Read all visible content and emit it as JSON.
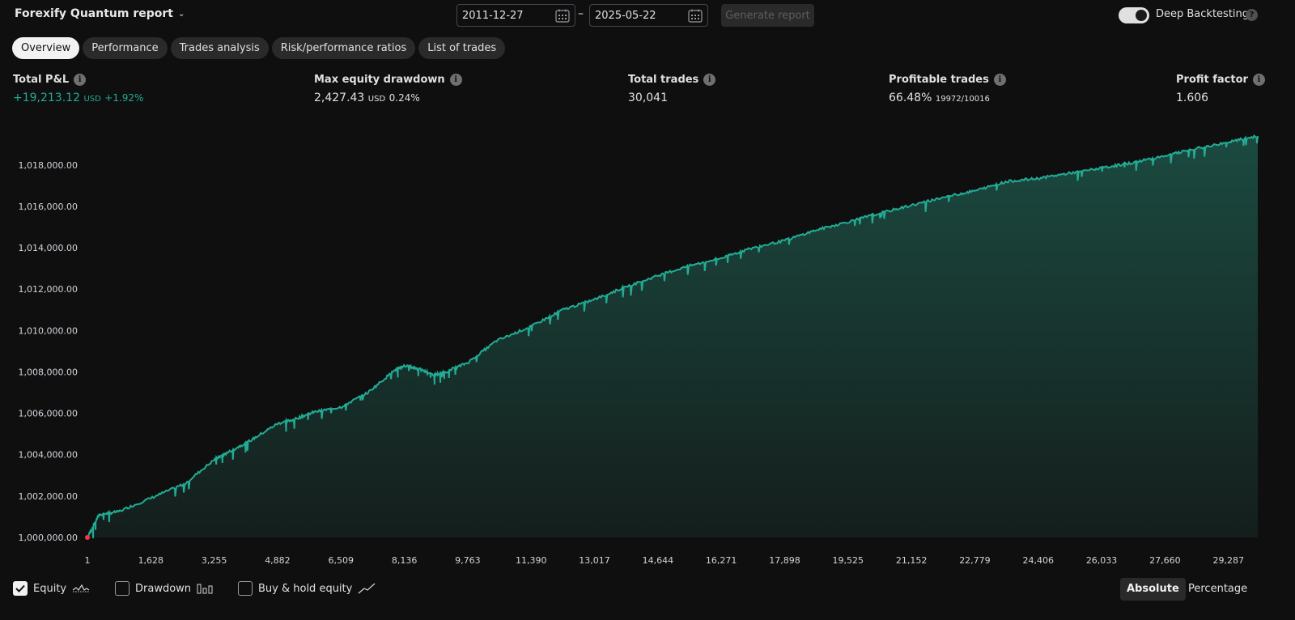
{
  "header": {
    "title": "Forexify Quantum report",
    "date_from": "2011-12-27",
    "date_to": "2025-05-22",
    "date_separator": "–",
    "generate_label": "Generate report",
    "deep_backtesting_label": "Deep Backtesting",
    "deep_backtesting_on": true
  },
  "tabs": [
    {
      "label": "Overview",
      "active": true
    },
    {
      "label": "Performance",
      "active": false
    },
    {
      "label": "Trades analysis",
      "active": false
    },
    {
      "label": "Risk/performance ratios",
      "active": false
    },
    {
      "label": "List of trades",
      "active": false
    }
  ],
  "metrics": {
    "total_pnl": {
      "label": "Total P&L",
      "value": "+19,213.12",
      "unit": "USD",
      "percent": "+1.92%"
    },
    "max_drawdown": {
      "label": "Max equity drawdown",
      "value": "2,427.43",
      "unit": "USD",
      "percent": "0.24%"
    },
    "total_trades": {
      "label": "Total trades",
      "value": "30,041"
    },
    "profitable_trades": {
      "label": "Profitable trades",
      "value": "66.48%",
      "ratio": "19972/10016"
    },
    "profit_factor": {
      "label": "Profit factor",
      "value": "1.606"
    }
  },
  "colors": {
    "equity_line": "#22ab94",
    "equity_fill_top": "#1b4a40",
    "equity_fill_bottom": "#141e1c",
    "background": "#0f0f0f"
  },
  "chart_data": {
    "type": "area",
    "y_tick_labels": [
      "1,000,000.00",
      "1,002,000.00",
      "1,004,000.00",
      "1,006,000.00",
      "1,008,000.00",
      "1,010,000.00",
      "1,012,000.00",
      "1,014,000.00",
      "1,016,000.00",
      "1,018,000.00"
    ],
    "y_ticks": [
      1000000,
      1002000,
      1004000,
      1006000,
      1008000,
      1010000,
      1012000,
      1014000,
      1016000,
      1018000
    ],
    "x_tick_labels": [
      "1",
      "1,628",
      "3,255",
      "4,882",
      "6,509",
      "8,136",
      "9,763",
      "11,390",
      "13,017",
      "14,644",
      "16,271",
      "17,898",
      "19,525",
      "21,152",
      "22,779",
      "24,406",
      "26,033",
      "27,660",
      "29,287"
    ],
    "x_ticks": [
      1,
      1628,
      3255,
      4882,
      6509,
      8136,
      9763,
      11390,
      13017,
      14644,
      16271,
      17898,
      19525,
      21152,
      22779,
      24406,
      26033,
      27660,
      29287
    ],
    "xlim": [
      1,
      30041
    ],
    "ylim": [
      1000000,
      1019400
    ],
    "series": [
      {
        "x": [
          1,
          300,
          800,
          1628,
          2500,
          3255,
          3600,
          4200,
          4882,
          5300,
          5800,
          6509,
          7200,
          7900,
          8136,
          8500,
          8900,
          9200,
          9763,
          10500,
          11390,
          12200,
          13017,
          13800,
          14644,
          15400,
          16271,
          17000,
          17898,
          18700,
          19525,
          20300,
          21152,
          22000,
          22779,
          23600,
          24406,
          25200,
          26033,
          26800,
          27660,
          28500,
          29287,
          30041
        ],
        "y": [
          1000000,
          1001100,
          1001250,
          1001900,
          1002600,
          1003750,
          1004100,
          1004700,
          1005500,
          1005700,
          1006050,
          1006300,
          1007000,
          1008100,
          1008300,
          1008150,
          1007850,
          1008000,
          1008450,
          1009500,
          1010200,
          1011000,
          1011500,
          1012100,
          1012650,
          1013100,
          1013500,
          1013950,
          1014350,
          1014850,
          1015250,
          1015650,
          1016050,
          1016450,
          1016750,
          1017200,
          1017350,
          1017600,
          1017850,
          1018100,
          1018450,
          1018800,
          1019100,
          1019400
        ]
      }
    ]
  },
  "legend": {
    "equity": {
      "label": "Equity",
      "checked": true
    },
    "drawdown": {
      "label": "Drawdown",
      "checked": false
    },
    "buy_hold": {
      "label": "Buy & hold equity",
      "checked": false
    }
  },
  "view_modes": {
    "absolute": "Absolute",
    "percentage": "Percentage"
  }
}
